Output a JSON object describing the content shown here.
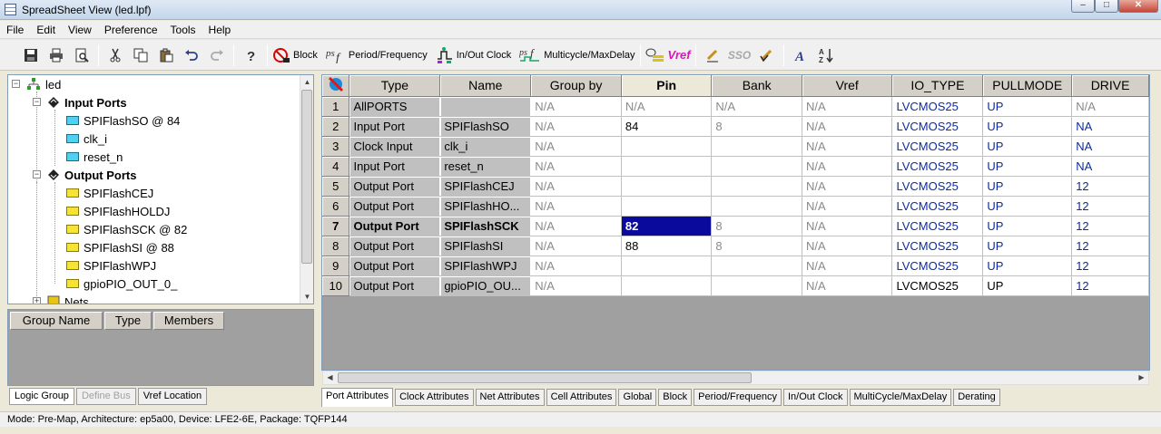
{
  "window": {
    "title": "SpreadSheet View (led.lpf)"
  },
  "menu": [
    "File",
    "Edit",
    "View",
    "Preference",
    "Tools",
    "Help"
  ],
  "toolbar": {
    "block": "Block",
    "period": "Period/Frequency",
    "inout": "In/Out Clock",
    "multicycle": "Multicycle/MaxDelay",
    "vref": "Vref",
    "sso": "SSO"
  },
  "tree": {
    "root": "led",
    "input_ports_label": "Input Ports",
    "input_ports": [
      "SPIFlashSO @ 84",
      "clk_i",
      "reset_n"
    ],
    "output_ports_label": "Output Ports",
    "output_ports": [
      "SPIFlashCEJ",
      "SPIFlashHOLDJ",
      "SPIFlashSCK @ 82",
      "SPIFlashSI @ 88",
      "SPIFlashWPJ",
      "gpioPIO_OUT_0_"
    ],
    "nets_label": "Nets"
  },
  "group_table": {
    "columns": [
      "Group Name",
      "Type",
      "Members"
    ]
  },
  "left_tabs": [
    "Logic Group",
    "Define Bus",
    "Vref Location"
  ],
  "grid": {
    "columns": [
      "Type",
      "Name",
      "Group by",
      "Pin",
      "Bank",
      "Vref",
      "IO_TYPE",
      "PULLMODE",
      "DRIVE"
    ],
    "rows": [
      {
        "n": "1",
        "type": "AllPORTS",
        "name": "",
        "group": "N/A",
        "pin": "N/A",
        "bank": "N/A",
        "vref": "N/A",
        "io": "LVCMOS25",
        "pull": "UP",
        "drive": "N/A"
      },
      {
        "n": "2",
        "type": "Input Port",
        "name": "SPIFlashSO",
        "group": "N/A",
        "pin": "84",
        "bank": "8",
        "vref": "N/A",
        "io": "LVCMOS25",
        "pull": "UP",
        "drive": "NA"
      },
      {
        "n": "3",
        "type": "Clock Input",
        "name": "clk_i",
        "group": "N/A",
        "pin": "",
        "bank": "",
        "vref": "N/A",
        "io": "LVCMOS25",
        "pull": "UP",
        "drive": "NA"
      },
      {
        "n": "4",
        "type": "Input Port",
        "name": "reset_n",
        "group": "N/A",
        "pin": "",
        "bank": "",
        "vref": "N/A",
        "io": "LVCMOS25",
        "pull": "UP",
        "drive": "NA"
      },
      {
        "n": "5",
        "type": "Output Port",
        "name": "SPIFlashCEJ",
        "group": "N/A",
        "pin": "",
        "bank": "",
        "vref": "N/A",
        "io": "LVCMOS25",
        "pull": "UP",
        "drive": "12"
      },
      {
        "n": "6",
        "type": "Output Port",
        "name": "SPIFlashHO...",
        "group": "N/A",
        "pin": "",
        "bank": "",
        "vref": "N/A",
        "io": "LVCMOS25",
        "pull": "UP",
        "drive": "12"
      },
      {
        "n": "7",
        "type": "Output Port",
        "name": "SPIFlashSCK",
        "group": "N/A",
        "pin": "82",
        "bank": "8",
        "vref": "N/A",
        "io": "LVCMOS25",
        "pull": "UP",
        "drive": "12"
      },
      {
        "n": "8",
        "type": "Output Port",
        "name": "SPIFlashSI",
        "group": "N/A",
        "pin": "88",
        "bank": "8",
        "vref": "N/A",
        "io": "LVCMOS25",
        "pull": "UP",
        "drive": "12"
      },
      {
        "n": "9",
        "type": "Output Port",
        "name": "SPIFlashWPJ",
        "group": "N/A",
        "pin": "",
        "bank": "",
        "vref": "N/A",
        "io": "LVCMOS25",
        "pull": "UP",
        "drive": "12"
      },
      {
        "n": "10",
        "type": "Output Port",
        "name": "gpioPIO_OU...",
        "group": "N/A",
        "pin": "",
        "bank": "",
        "vref": "N/A",
        "io": "LVCMOS25",
        "pull": "UP",
        "drive": "12"
      }
    ]
  },
  "grid_tabs": [
    "Port Attributes",
    "Clock Attributes",
    "Net Attributes",
    "Cell Attributes",
    "Global",
    "Block",
    "Period/Frequency",
    "In/Out Clock",
    "MultiCycle/MaxDelay",
    "Derating"
  ],
  "status": "Mode: Pre-Map,    Architecture: ep5a00,  Device: LFE2-6E,  Package: TQFP144",
  "colors": {
    "selection": "#0a0a9c",
    "io_text": "#0b2d9e",
    "na_text": "#8a8a8a",
    "grid_background": "#a0a0a0"
  }
}
